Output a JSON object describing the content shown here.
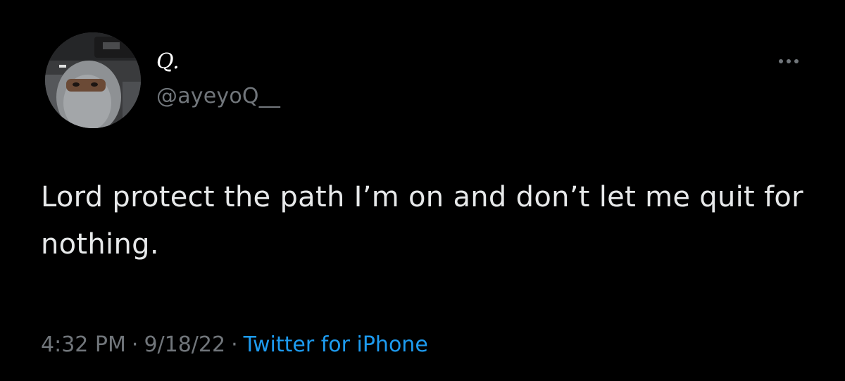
{
  "tweet": {
    "display_name": "Q.",
    "handle": "@ayeyoQ__",
    "text": "Lord protect the path I’m on and don’t let me quit for nothing.",
    "time": "4:32 PM",
    "separator": "·",
    "date": "9/18/22",
    "source": "Twitter for iPhone"
  },
  "icons": {
    "avatar": "profile-photo",
    "more": "more-horizontal-icon"
  },
  "colors": {
    "background": "#000000",
    "text": "#e7e9ea",
    "secondary": "#71767b",
    "accent": "#1d9bf0"
  }
}
